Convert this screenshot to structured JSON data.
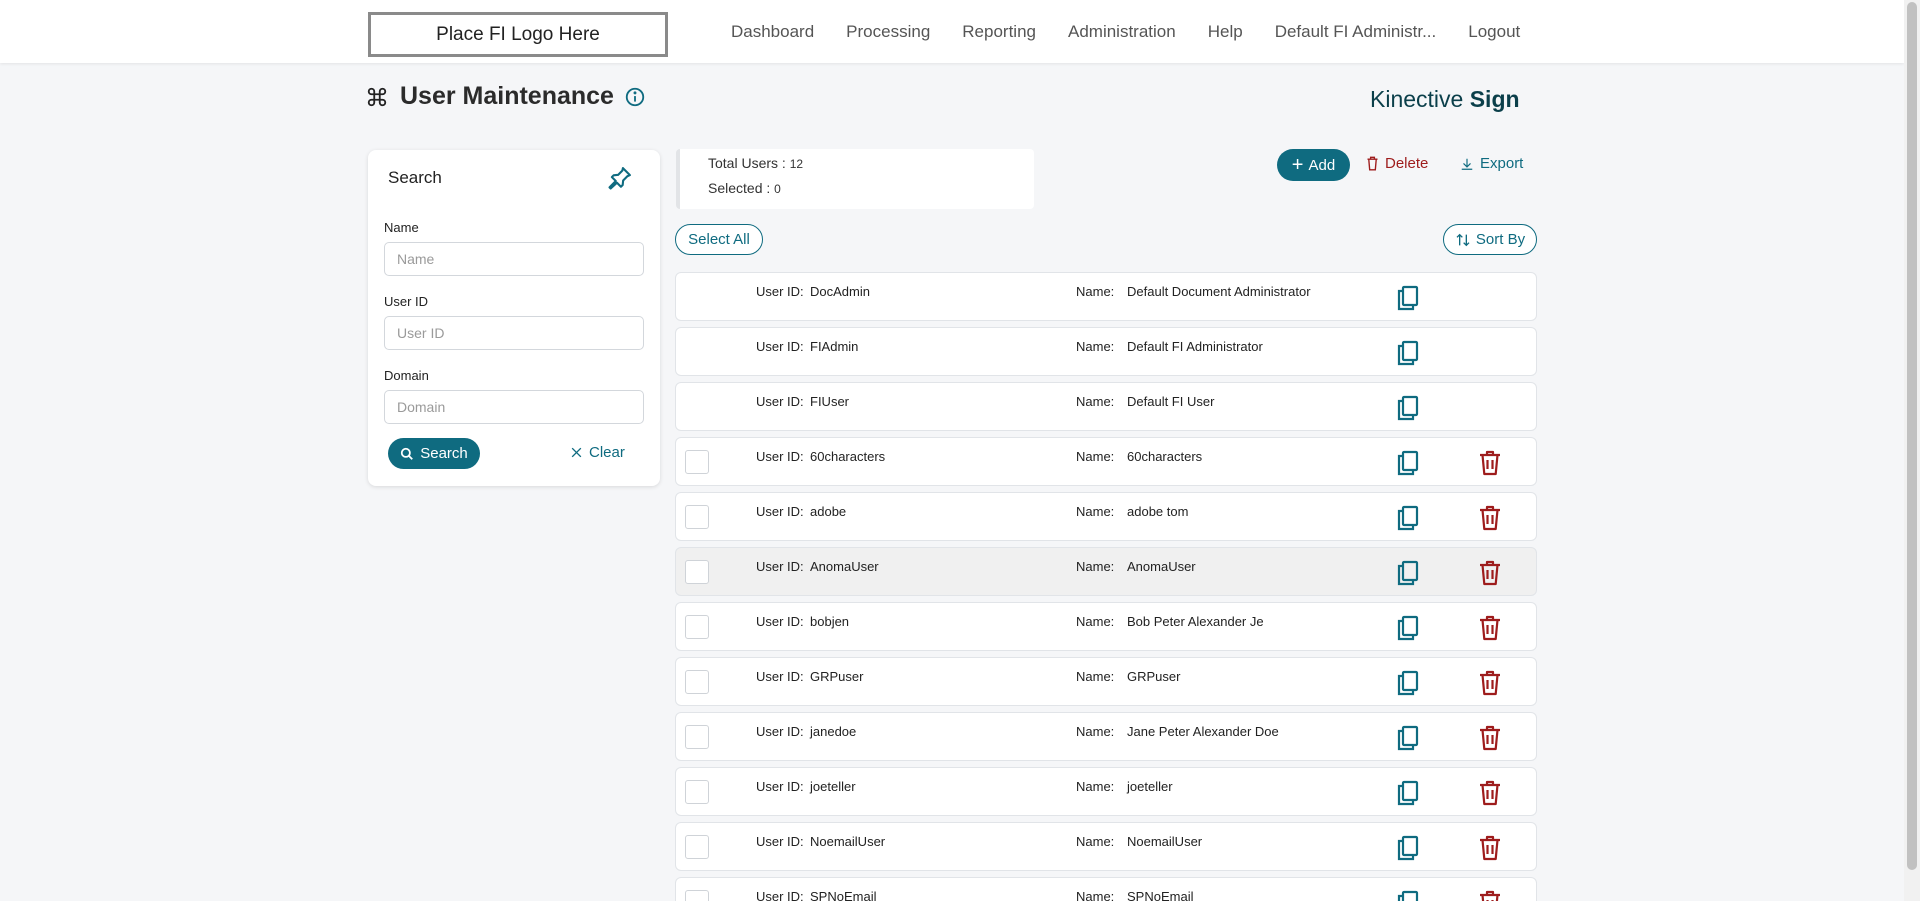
{
  "header": {
    "logo_text": "Place FI Logo Here",
    "nav": [
      "Dashboard",
      "Processing",
      "Reporting",
      "Administration",
      "Help",
      "Default FI Administr...",
      "Logout"
    ]
  },
  "page": {
    "title": "User Maintenance",
    "brand_light": "Kinective",
    "brand_bold": "Sign"
  },
  "search": {
    "title": "Search",
    "name_label": "Name",
    "name_placeholder": "Name",
    "userid_label": "User ID",
    "userid_placeholder": "User ID",
    "domain_label": "Domain",
    "domain_placeholder": "Domain",
    "search_label": "Search",
    "clear_label": "Clear"
  },
  "summary": {
    "total_label": "Total Users :",
    "total_value": "12",
    "selected_label": "Selected :",
    "selected_value": "0"
  },
  "actions": {
    "add_label": "Add",
    "delete_label": "Delete",
    "export_label": "Export",
    "select_all_label": "Select All",
    "sort_label": "Sort By"
  },
  "list": {
    "userid_label": "User ID:",
    "name_label": "Name:",
    "rows": [
      {
        "user_id": "DocAdmin",
        "name": "Default Document Administrator",
        "deletable": false
      },
      {
        "user_id": "FIAdmin",
        "name": "Default FI Administrator",
        "deletable": false
      },
      {
        "user_id": "FIUser",
        "name": "Default FI User",
        "deletable": false
      },
      {
        "user_id": "60characters",
        "name": "60characters",
        "deletable": true
      },
      {
        "user_id": "adobe",
        "name": "adobe tom",
        "deletable": true
      },
      {
        "user_id": "AnomaUser",
        "name": "AnomaUser",
        "deletable": true,
        "highlighted": true
      },
      {
        "user_id": "bobjen",
        "name": "Bob Peter Alexander Je",
        "deletable": true
      },
      {
        "user_id": "GRPuser",
        "name": "GRPuser",
        "deletable": true
      },
      {
        "user_id": "janedoe",
        "name": "Jane Peter Alexander Doe",
        "deletable": true
      },
      {
        "user_id": "joeteller",
        "name": "joeteller",
        "deletable": true
      },
      {
        "user_id": "NoemailUser",
        "name": "NoemailUser",
        "deletable": true
      },
      {
        "user_id": "SPNoEmail",
        "name": "SPNoEmail",
        "deletable": true
      }
    ]
  },
  "colors": {
    "accent": "#0f6b80",
    "danger": "#9e1c1c",
    "background": "#f5f6f8"
  },
  "icons": {
    "title": "command-icon",
    "info": "info-icon",
    "pin": "pin-icon",
    "copy": "copy-icon",
    "trash": "trash-icon"
  }
}
